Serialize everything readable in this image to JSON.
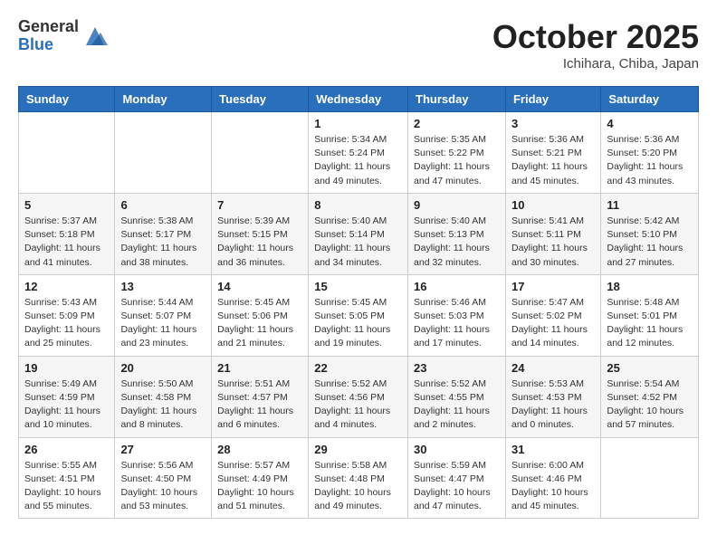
{
  "header": {
    "logo_general": "General",
    "logo_blue": "Blue",
    "month": "October 2025",
    "location": "Ichihara, Chiba, Japan"
  },
  "weekdays": [
    "Sunday",
    "Monday",
    "Tuesday",
    "Wednesday",
    "Thursday",
    "Friday",
    "Saturday"
  ],
  "weeks": [
    [
      {
        "day": "",
        "sunrise": "",
        "sunset": "",
        "daylight": ""
      },
      {
        "day": "",
        "sunrise": "",
        "sunset": "",
        "daylight": ""
      },
      {
        "day": "",
        "sunrise": "",
        "sunset": "",
        "daylight": ""
      },
      {
        "day": "1",
        "sunrise": "Sunrise: 5:34 AM",
        "sunset": "Sunset: 5:24 PM",
        "daylight": "Daylight: 11 hours and 49 minutes."
      },
      {
        "day": "2",
        "sunrise": "Sunrise: 5:35 AM",
        "sunset": "Sunset: 5:22 PM",
        "daylight": "Daylight: 11 hours and 47 minutes."
      },
      {
        "day": "3",
        "sunrise": "Sunrise: 5:36 AM",
        "sunset": "Sunset: 5:21 PM",
        "daylight": "Daylight: 11 hours and 45 minutes."
      },
      {
        "day": "4",
        "sunrise": "Sunrise: 5:36 AM",
        "sunset": "Sunset: 5:20 PM",
        "daylight": "Daylight: 11 hours and 43 minutes."
      }
    ],
    [
      {
        "day": "5",
        "sunrise": "Sunrise: 5:37 AM",
        "sunset": "Sunset: 5:18 PM",
        "daylight": "Daylight: 11 hours and 41 minutes."
      },
      {
        "day": "6",
        "sunrise": "Sunrise: 5:38 AM",
        "sunset": "Sunset: 5:17 PM",
        "daylight": "Daylight: 11 hours and 38 minutes."
      },
      {
        "day": "7",
        "sunrise": "Sunrise: 5:39 AM",
        "sunset": "Sunset: 5:15 PM",
        "daylight": "Daylight: 11 hours and 36 minutes."
      },
      {
        "day": "8",
        "sunrise": "Sunrise: 5:40 AM",
        "sunset": "Sunset: 5:14 PM",
        "daylight": "Daylight: 11 hours and 34 minutes."
      },
      {
        "day": "9",
        "sunrise": "Sunrise: 5:40 AM",
        "sunset": "Sunset: 5:13 PM",
        "daylight": "Daylight: 11 hours and 32 minutes."
      },
      {
        "day": "10",
        "sunrise": "Sunrise: 5:41 AM",
        "sunset": "Sunset: 5:11 PM",
        "daylight": "Daylight: 11 hours and 30 minutes."
      },
      {
        "day": "11",
        "sunrise": "Sunrise: 5:42 AM",
        "sunset": "Sunset: 5:10 PM",
        "daylight": "Daylight: 11 hours and 27 minutes."
      }
    ],
    [
      {
        "day": "12",
        "sunrise": "Sunrise: 5:43 AM",
        "sunset": "Sunset: 5:09 PM",
        "daylight": "Daylight: 11 hours and 25 minutes."
      },
      {
        "day": "13",
        "sunrise": "Sunrise: 5:44 AM",
        "sunset": "Sunset: 5:07 PM",
        "daylight": "Daylight: 11 hours and 23 minutes."
      },
      {
        "day": "14",
        "sunrise": "Sunrise: 5:45 AM",
        "sunset": "Sunset: 5:06 PM",
        "daylight": "Daylight: 11 hours and 21 minutes."
      },
      {
        "day": "15",
        "sunrise": "Sunrise: 5:45 AM",
        "sunset": "Sunset: 5:05 PM",
        "daylight": "Daylight: 11 hours and 19 minutes."
      },
      {
        "day": "16",
        "sunrise": "Sunrise: 5:46 AM",
        "sunset": "Sunset: 5:03 PM",
        "daylight": "Daylight: 11 hours and 17 minutes."
      },
      {
        "day": "17",
        "sunrise": "Sunrise: 5:47 AM",
        "sunset": "Sunset: 5:02 PM",
        "daylight": "Daylight: 11 hours and 14 minutes."
      },
      {
        "day": "18",
        "sunrise": "Sunrise: 5:48 AM",
        "sunset": "Sunset: 5:01 PM",
        "daylight": "Daylight: 11 hours and 12 minutes."
      }
    ],
    [
      {
        "day": "19",
        "sunrise": "Sunrise: 5:49 AM",
        "sunset": "Sunset: 4:59 PM",
        "daylight": "Daylight: 11 hours and 10 minutes."
      },
      {
        "day": "20",
        "sunrise": "Sunrise: 5:50 AM",
        "sunset": "Sunset: 4:58 PM",
        "daylight": "Daylight: 11 hours and 8 minutes."
      },
      {
        "day": "21",
        "sunrise": "Sunrise: 5:51 AM",
        "sunset": "Sunset: 4:57 PM",
        "daylight": "Daylight: 11 hours and 6 minutes."
      },
      {
        "day": "22",
        "sunrise": "Sunrise: 5:52 AM",
        "sunset": "Sunset: 4:56 PM",
        "daylight": "Daylight: 11 hours and 4 minutes."
      },
      {
        "day": "23",
        "sunrise": "Sunrise: 5:52 AM",
        "sunset": "Sunset: 4:55 PM",
        "daylight": "Daylight: 11 hours and 2 minutes."
      },
      {
        "day": "24",
        "sunrise": "Sunrise: 5:53 AM",
        "sunset": "Sunset: 4:53 PM",
        "daylight": "Daylight: 11 hours and 0 minutes."
      },
      {
        "day": "25",
        "sunrise": "Sunrise: 5:54 AM",
        "sunset": "Sunset: 4:52 PM",
        "daylight": "Daylight: 10 hours and 57 minutes."
      }
    ],
    [
      {
        "day": "26",
        "sunrise": "Sunrise: 5:55 AM",
        "sunset": "Sunset: 4:51 PM",
        "daylight": "Daylight: 10 hours and 55 minutes."
      },
      {
        "day": "27",
        "sunrise": "Sunrise: 5:56 AM",
        "sunset": "Sunset: 4:50 PM",
        "daylight": "Daylight: 10 hours and 53 minutes."
      },
      {
        "day": "28",
        "sunrise": "Sunrise: 5:57 AM",
        "sunset": "Sunset: 4:49 PM",
        "daylight": "Daylight: 10 hours and 51 minutes."
      },
      {
        "day": "29",
        "sunrise": "Sunrise: 5:58 AM",
        "sunset": "Sunset: 4:48 PM",
        "daylight": "Daylight: 10 hours and 49 minutes."
      },
      {
        "day": "30",
        "sunrise": "Sunrise: 5:59 AM",
        "sunset": "Sunset: 4:47 PM",
        "daylight": "Daylight: 10 hours and 47 minutes."
      },
      {
        "day": "31",
        "sunrise": "Sunrise: 6:00 AM",
        "sunset": "Sunset: 4:46 PM",
        "daylight": "Daylight: 10 hours and 45 minutes."
      },
      {
        "day": "",
        "sunrise": "",
        "sunset": "",
        "daylight": ""
      }
    ]
  ]
}
